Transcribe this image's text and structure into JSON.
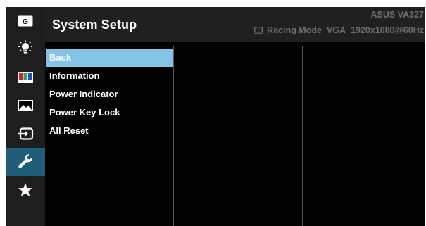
{
  "header": {
    "title": "System Setup",
    "model": "ASUS  VA327",
    "mode": "Racing Mode",
    "input": "VGA",
    "resolution": "1920x1080@60Hz"
  },
  "menu": {
    "items": [
      {
        "label": "Back",
        "selected": true
      },
      {
        "label": "Information",
        "selected": false
      },
      {
        "label": "Power Indicator",
        "selected": false
      },
      {
        "label": "Power Key Lock",
        "selected": false
      },
      {
        "label": "All Reset",
        "selected": false
      }
    ]
  },
  "rail": {
    "items": [
      {
        "icon": "gameplus-icon",
        "label": "G"
      },
      {
        "icon": "brightness-icon"
      },
      {
        "icon": "color-icon"
      },
      {
        "icon": "image-icon"
      },
      {
        "icon": "input-select-icon"
      },
      {
        "icon": "system-setup-wrench-icon",
        "active": true
      },
      {
        "icon": "shortcut-star-icon"
      }
    ]
  },
  "colors": {
    "selected_bg": "#83c3e6",
    "active_rail": "#1f5d78",
    "header_bg": "#202020",
    "rail_bg": "#1e1e1e"
  }
}
